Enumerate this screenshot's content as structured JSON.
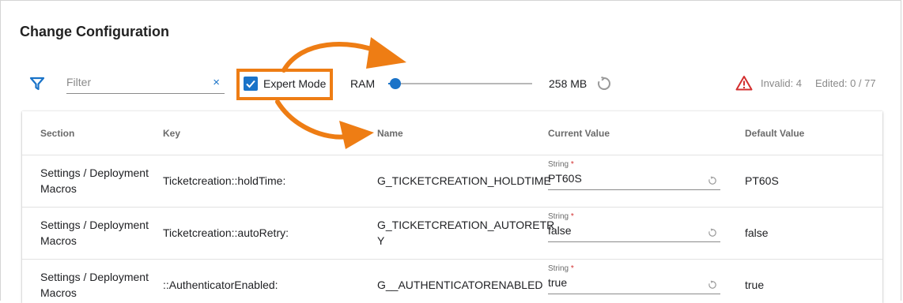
{
  "page": {
    "title": "Change Configuration"
  },
  "toolbar": {
    "filter_placeholder": "Filter",
    "filter_value": "",
    "clear_glyph": "×",
    "expert_mode_label": "Expert Mode",
    "expert_mode_checked": true,
    "ram_label": "RAM",
    "ram_slider_level": 0.05,
    "ram_value": "258 MB",
    "invalid_label": "Invalid: 4",
    "edited_label": "Edited: 0 / 77"
  },
  "table": {
    "headers": {
      "section": "Section",
      "key": "Key",
      "name": "Name",
      "current_value": "Current Value",
      "default_value": "Default Value"
    },
    "rows": [
      {
        "section_line1": "Settings / Deployment",
        "section_line2": "Macros",
        "key": "Ticketcreation::holdTime:",
        "name_line1": "G_TICKETCREATION_HOLDTIME",
        "name_line2": "",
        "value_type": "String",
        "required_mark": "*",
        "current_value": "PT60S",
        "default_value": "PT60S"
      },
      {
        "section_line1": "Settings / Deployment",
        "section_line2": "Macros",
        "key": "Ticketcreation::autoRetry:",
        "name_line1": "G_TICKETCREATION_AUTORETR",
        "name_line2": "Y",
        "value_type": "String",
        "required_mark": "*",
        "current_value": "false",
        "default_value": "false"
      },
      {
        "section_line1": "Settings / Deployment",
        "section_line2": "Macros",
        "key": "::AuthenticatorEnabled:",
        "name_line1": "G__AUTHENTICATORENABLED",
        "name_line2": "",
        "value_type": "String",
        "required_mark": "*",
        "current_value": "true",
        "default_value": "true"
      }
    ]
  },
  "icons": {
    "filter": "filter-icon",
    "clear": "close-icon",
    "checkbox": "checkmark-icon",
    "reset": "reset-icon",
    "warning": "warning-triangle-icon"
  },
  "colors": {
    "accent": "#1a73c8",
    "annotation": "#ee7d14",
    "warning": "#d32f2f",
    "muted_text": "#8a8a8a"
  }
}
